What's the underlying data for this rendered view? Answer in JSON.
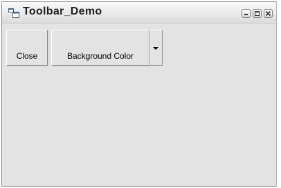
{
  "window": {
    "title": "Toolbar_Demo",
    "app_icon": "form-window-icon",
    "caption_buttons": [
      "minimize-icon",
      "maximize-icon",
      "close-icon"
    ]
  },
  "toolbar": {
    "close_label": "Close",
    "background_color_label": "Background Color",
    "dropdown_icon": "dropdown-arrow-icon"
  },
  "colors": {
    "client_area": "#e3e3e3",
    "titlebar": "#ececec"
  }
}
